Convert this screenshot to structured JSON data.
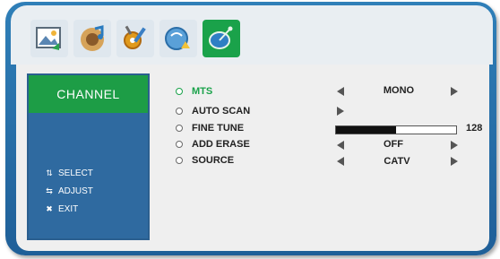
{
  "tabs": [
    {
      "name": "picture-tab",
      "icon": "picture-icon",
      "active": false
    },
    {
      "name": "audio-tab",
      "icon": "audio-icon",
      "active": false
    },
    {
      "name": "setup-tab",
      "icon": "setup-icon",
      "active": false
    },
    {
      "name": "time-tab",
      "icon": "time-icon",
      "active": false
    },
    {
      "name": "channel-tab",
      "icon": "channel-icon",
      "active": true
    }
  ],
  "sidebar": {
    "title": "CHANNEL",
    "legend": [
      {
        "glyph": "⇅",
        "label": "SELECT",
        "icon": "updown-arrows-icon"
      },
      {
        "glyph": "⇆",
        "label": "ADJUST",
        "icon": "leftright-arrows-icon"
      },
      {
        "glyph": "✖",
        "label": "EXIT",
        "icon": "exit-icon"
      }
    ]
  },
  "menu": {
    "items": [
      {
        "label": "MTS",
        "value": "MONO",
        "selected": true
      },
      {
        "label": "AUTO SCAN",
        "value": ""
      },
      {
        "label": "FINE TUNE",
        "level": 128,
        "level_max": 255
      },
      {
        "label": "ADD ERASE",
        "value": "OFF"
      },
      {
        "label": "SOURCE",
        "value": "CATV"
      }
    ]
  },
  "colors": {
    "frame": "#2f7fb8",
    "accent_green": "#1aa24a",
    "sidebar_blue": "#2f6aa0",
    "panel": "#efefef"
  }
}
